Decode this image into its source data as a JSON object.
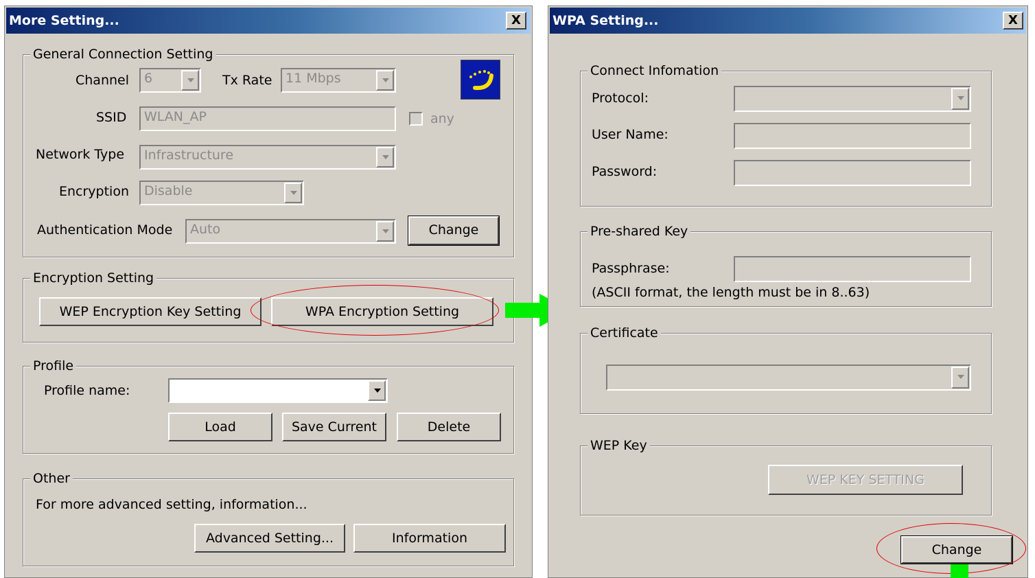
{
  "left_dialog": {
    "title": "More Setting...",
    "close": "X",
    "general": {
      "legend": "General Connection Setting",
      "channel_label": "Channel",
      "channel_value": "6",
      "txrate_label": "Tx Rate",
      "txrate_value": "11 Mbps",
      "ssid_label": "SSID",
      "ssid_value": "WLAN_AP",
      "any_label": "any",
      "nettype_label": "Network Type",
      "nettype_value": "Infrastructure",
      "encryption_label": "Encryption",
      "encryption_value": "Disable",
      "auth_label": "Authentication Mode",
      "auth_value": "Auto",
      "change_button": "Change"
    },
    "encryption_setting": {
      "legend": "Encryption Setting",
      "wep_button": "WEP Encryption Key Setting",
      "wpa_button": "WPA Encryption Setting"
    },
    "profile": {
      "legend": "Profile",
      "name_label": "Profile name:",
      "name_value": "",
      "load_button": "Load",
      "save_button": "Save Current",
      "delete_button": "Delete"
    },
    "other": {
      "legend": "Other",
      "text": "For more advanced setting, information...",
      "advanced_button": "Advanced Setting...",
      "information_button": "Information"
    }
  },
  "right_dialog": {
    "title": "WPA Setting...",
    "close": "X",
    "connect": {
      "legend": "Connect Infomation",
      "protocol_label": "Protocol:",
      "username_label": "User Name:",
      "password_label": "Password:"
    },
    "preshared": {
      "legend": "Pre-shared Key",
      "passphrase_label": "Passphrase:",
      "note": "(ASCII format, the length must be in 8..63)"
    },
    "certificate": {
      "legend": "Certificate"
    },
    "wepkey": {
      "legend": "WEP Key",
      "button": "WEP KEY SETTING"
    },
    "change_button": "Change"
  },
  "annotation_colors": {
    "highlight_ellipse": "#e00000",
    "arrow": "#00ee00"
  }
}
